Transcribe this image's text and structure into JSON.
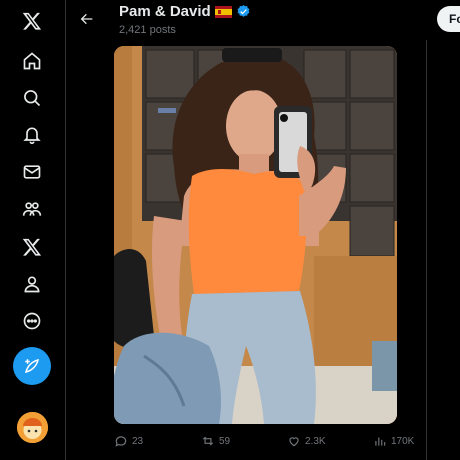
{
  "header": {
    "title": "Pam & David",
    "posts_count": "2,421 posts",
    "follow_label": "Fo"
  },
  "nav": {
    "icons": [
      "x-logo-icon",
      "home-icon",
      "search-icon",
      "notifications-icon",
      "messages-icon",
      "communities-icon",
      "premium-icon",
      "profile-icon",
      "more-icon"
    ]
  },
  "actions": {
    "replies": "23",
    "reposts": "59",
    "likes": "2.3K",
    "views": "170K"
  },
  "colors": {
    "accent": "#1d9bf0",
    "background": "#000000",
    "muted_text": "#71767b",
    "top_color": "#ff8a3d"
  }
}
